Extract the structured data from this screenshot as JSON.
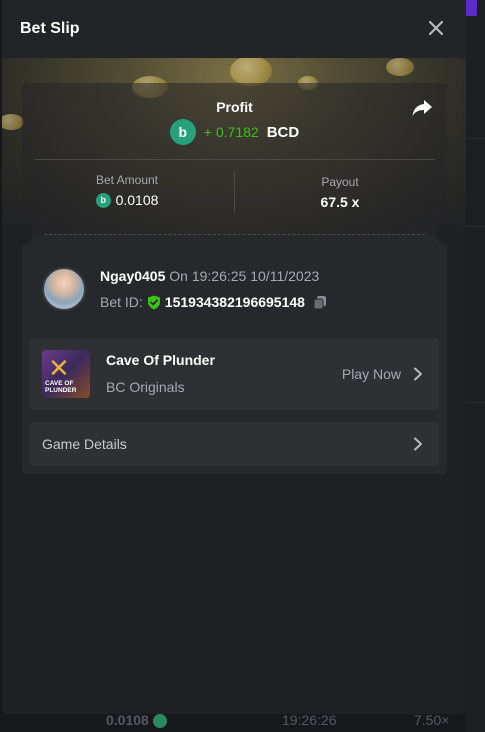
{
  "modal": {
    "title": "Bet Slip"
  },
  "profit": {
    "label": "Profit",
    "value": "+ 0.7182",
    "currency": "BCD",
    "coin_glyph": "b"
  },
  "bet_amount": {
    "label": "Bet Amount",
    "value": "0.0108"
  },
  "payout": {
    "label": "Payout",
    "value": "67.5 x"
  },
  "user": {
    "name": "Ngay0405",
    "time_text": " On 19:26:25 10/11/2023",
    "bet_id_label": "Bet ID:",
    "bet_id": "151934382196695148"
  },
  "game": {
    "name": "Cave Of Plunder",
    "provider": "BC Originals",
    "play_label": "Play Now",
    "thumb_text": "CAVE OF PLUNDER"
  },
  "details": {
    "label": "Game Details"
  },
  "background_row": {
    "amount": "0.0108",
    "time": "19:26:26",
    "payout": "7.50×"
  },
  "colors": {
    "accent_green": "#3bc117",
    "coin": "#26a17b",
    "background": "#17181b",
    "modal": "#1f2023"
  },
  "icons": [
    "close-icon",
    "share-icon",
    "coin-icon",
    "shield-check-icon",
    "copy-icon",
    "chevron-right-icon"
  ]
}
